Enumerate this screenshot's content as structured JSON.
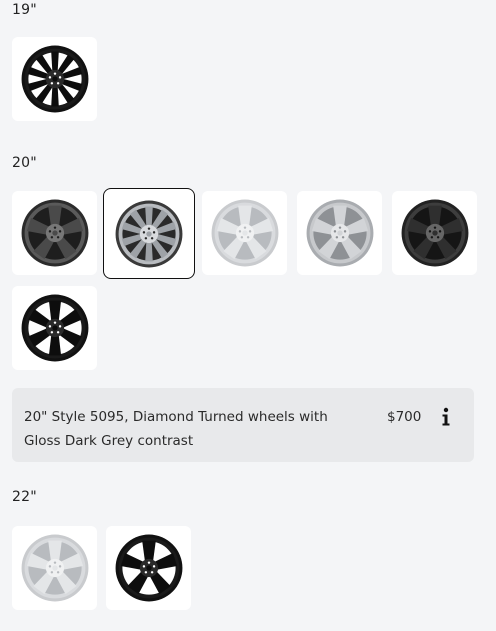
{
  "sections": [
    {
      "label": "19\"",
      "wheels": [
        {
          "id": "19-black",
          "finish": "gloss-black",
          "style": "split-10",
          "selected": false
        }
      ]
    },
    {
      "label": "20\"",
      "wheels": [
        {
          "id": "20-dark-grey-5",
          "finish": "dark-grey",
          "style": "5-spoke",
          "selected": false
        },
        {
          "id": "20-diamond-turned",
          "finish": "diamond-turned",
          "style": "split-5",
          "selected": true
        },
        {
          "id": "20-silver-5",
          "finish": "silver",
          "style": "5-spoke",
          "selected": false
        },
        {
          "id": "20-satin-silver-5",
          "finish": "satin-silver",
          "style": "5-spoke",
          "selected": false
        },
        {
          "id": "20-gunmetal-5",
          "finish": "gunmetal",
          "style": "5-spoke",
          "selected": false
        },
        {
          "id": "20-black-6",
          "finish": "gloss-black",
          "style": "6-spoke",
          "selected": false
        }
      ]
    },
    {
      "label": "22\"",
      "wheels": [
        {
          "id": "22-silver-5",
          "finish": "silver",
          "style": "5-spoke",
          "selected": false
        },
        {
          "id": "22-black-5",
          "finish": "gloss-black",
          "style": "5-spoke",
          "selected": false
        }
      ]
    }
  ],
  "selected_info": {
    "description": "20\" Style 5095, Diamond Turned wheels with Gloss Dark Grey contrast",
    "price": "$700",
    "info_icon": "info-icon"
  },
  "colors": {
    "background": "#f4f5f7",
    "tile": "#ffffff",
    "panel": "#e8e9eb",
    "selected_border": "#111111"
  }
}
